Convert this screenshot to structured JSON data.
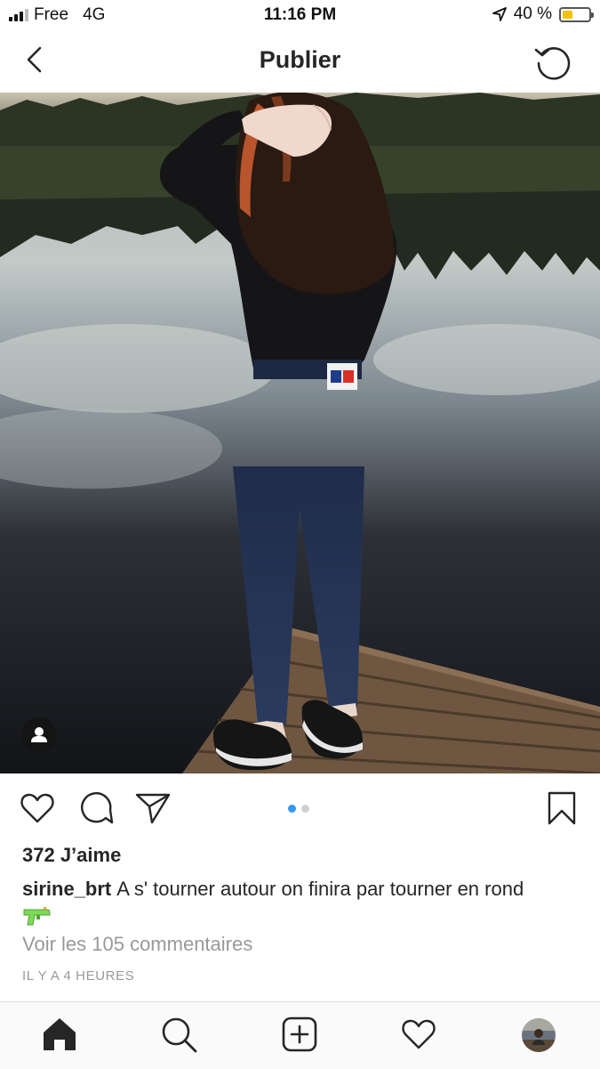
{
  "status_bar": {
    "carrier": "Free",
    "network": "4G",
    "time": "11:16 PM",
    "battery_text": "40 %",
    "battery_level": 0.4,
    "battery_color": "#f4c20d"
  },
  "header": {
    "title": "Publier",
    "back_icon": "chevron-left-icon",
    "refresh_icon": "refresh-icon"
  },
  "post": {
    "carousel": {
      "count": 2,
      "active_index": 0,
      "active_color": "#3897f0",
      "inactive_color": "#d0d0d0"
    },
    "likes": "372 J’aime",
    "username": "sirine_brt",
    "caption": "A s' tourner autour on finira par tourner en rond",
    "caption_emoji": "water-pistol-emoji",
    "comments_link": "Voir les 105 commentaires",
    "timestamp": "IL Y A 4 HEURES"
  },
  "actions": [
    "heart-icon",
    "comment-icon",
    "share-icon",
    "bookmark-icon"
  ],
  "bottom_nav": [
    "home-icon",
    "search-icon",
    "add-icon",
    "activity-icon",
    "profile-avatar"
  ]
}
